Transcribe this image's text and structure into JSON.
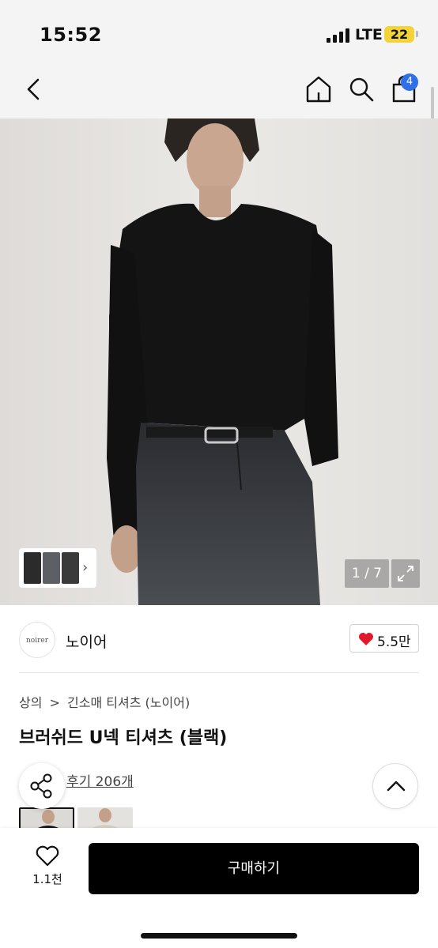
{
  "status_bar": {
    "time": "15:52",
    "network": "LTE",
    "battery": "22"
  },
  "nav": {
    "back_icon": "chevron-left-icon",
    "home_icon": "home-icon",
    "search_icon": "search-icon",
    "cart_icon": "shopping-bag-icon",
    "cart_count": "4"
  },
  "gallery": {
    "counter": "1 / 7",
    "expand_icon": "expand-icon",
    "more_icon": "chevron-right-icon"
  },
  "brand": {
    "logo_text": "noirer",
    "name": "노이어",
    "likes": "5.5만",
    "like_color": "#e0192d"
  },
  "breadcrumb": {
    "level1": "상의",
    "separator": ">",
    "level2": "긴소매 티셔츠 (노이어)"
  },
  "product": {
    "title": "브러쉬드 U넥 티셔츠 (블랙)",
    "reviews": "후기 206개"
  },
  "actions": {
    "share_icon": "share-icon",
    "scroll_top_icon": "chevron-up-icon"
  },
  "bottom_bar": {
    "wish_icon": "heart-outline-icon",
    "wish_count": "1.1천",
    "buy_label": "구매하기",
    "buy_color": "#000000"
  },
  "colors": {
    "badge": "#2f6fe8",
    "battery": "#f2d33a"
  }
}
